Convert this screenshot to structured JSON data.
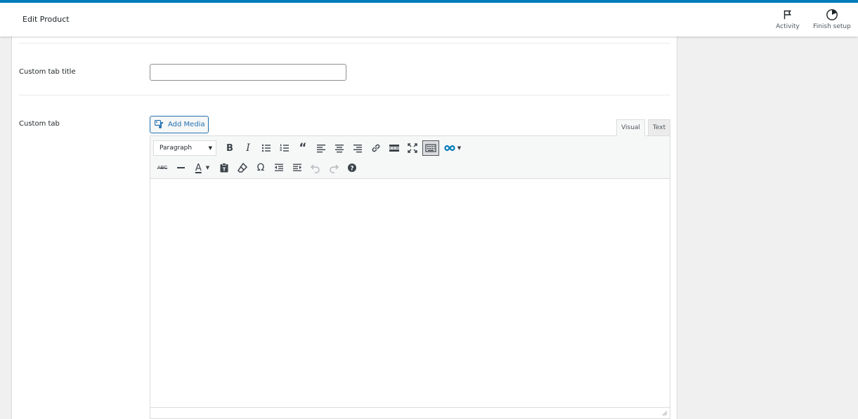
{
  "header": {
    "title": "Edit Product",
    "actions": [
      {
        "label": "Activity",
        "icon": "flag-icon"
      },
      {
        "label": "Finish setup",
        "icon": "progress-circle-icon"
      }
    ]
  },
  "fields": {
    "custom_tab_title": {
      "label": "Custom tab title",
      "value": "",
      "placeholder": ""
    },
    "custom_tab": {
      "label": "Custom tab"
    }
  },
  "editor": {
    "add_media": "Add Media",
    "tabs": {
      "visual": "Visual",
      "text": "Text"
    },
    "format_select": "Paragraph",
    "accent": "#007cba"
  }
}
